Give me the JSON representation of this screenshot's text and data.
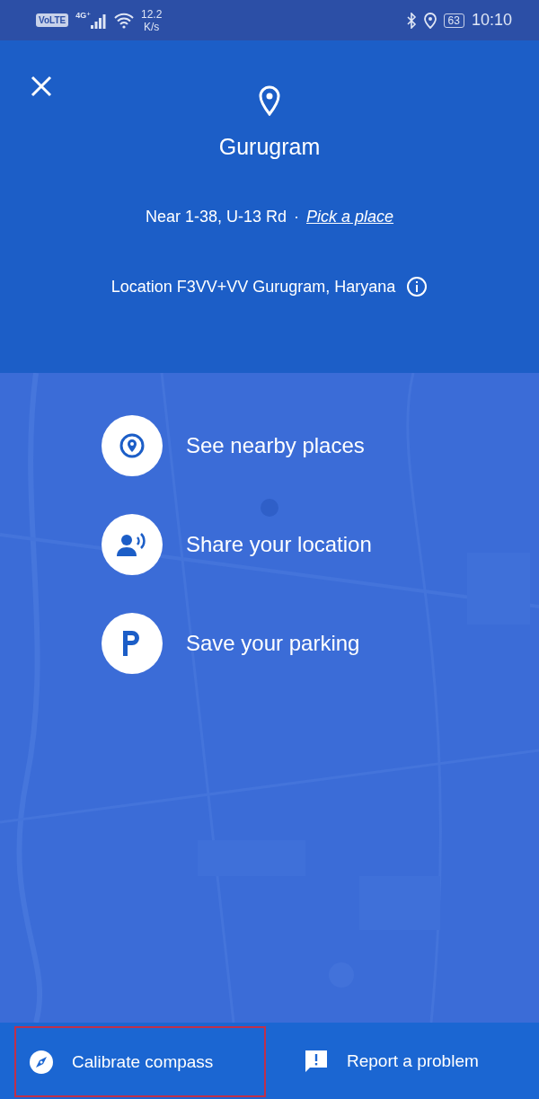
{
  "status_bar": {
    "volte": "VoLTE",
    "network": "4G⁺",
    "speed": "12.2",
    "speed_unit": "K/s",
    "battery": "63",
    "time": "10:10"
  },
  "header": {
    "title": "Gurugram",
    "near": "Near 1-38, U-13 Rd",
    "separator": "·",
    "pick_link": "Pick a place",
    "plus_code": "Location F3VV+VV Gurugram, Haryana"
  },
  "actions": [
    {
      "kind": "nearby",
      "label": "See nearby places"
    },
    {
      "kind": "share",
      "label": "Share your location"
    },
    {
      "kind": "parking",
      "label": "Save your parking"
    }
  ],
  "bottom_bar": [
    {
      "kind": "compass",
      "label": "Calibrate compass",
      "highlighted": true
    },
    {
      "kind": "report",
      "label": "Report a problem",
      "highlighted": false
    }
  ]
}
